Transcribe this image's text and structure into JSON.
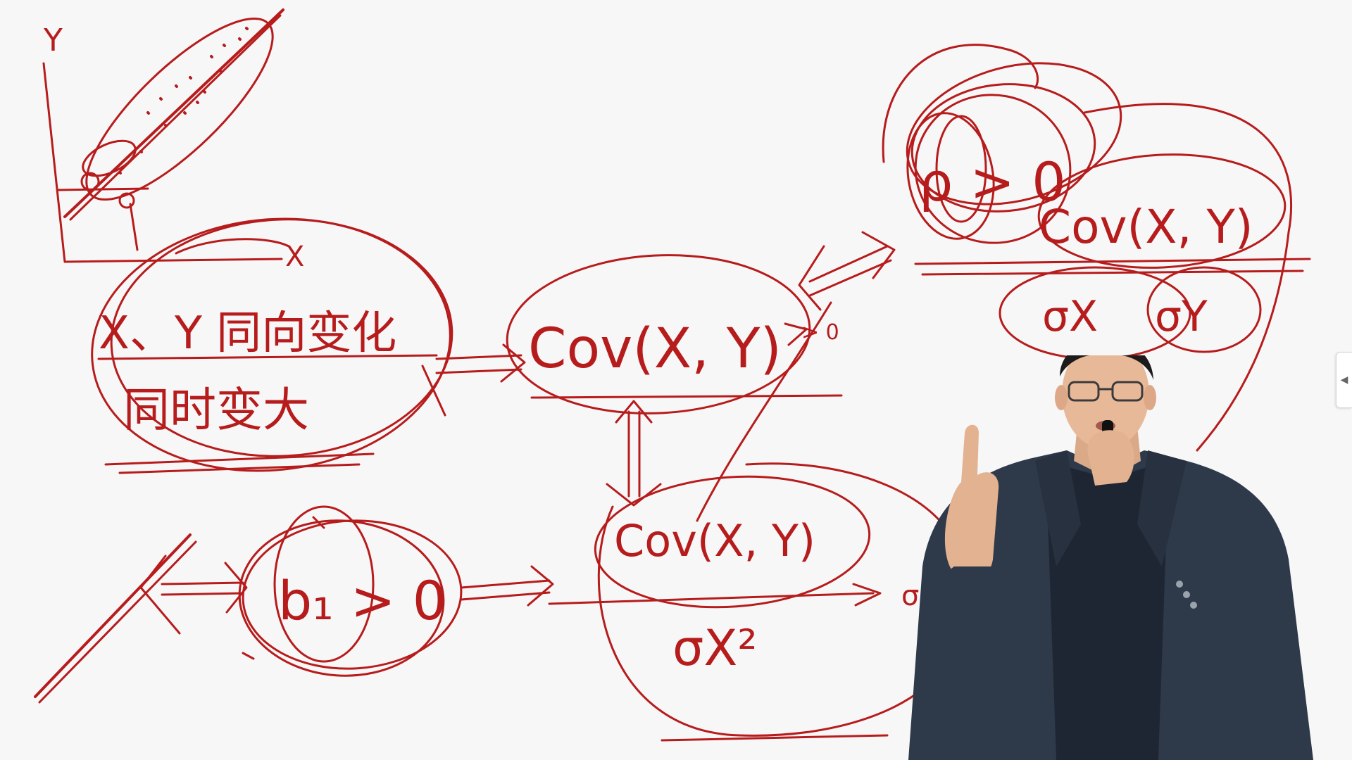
{
  "board": {
    "ink_color": "#b71c1c",
    "background_color": "#f7f7f8",
    "labels": {
      "axis_y": "Y",
      "axis_x": "X",
      "left_oval_line1": "X、Y 同向变化",
      "left_oval_line2": "同时变大",
      "center_top": "Cov(X, Y)",
      "center_top_result": "> 0",
      "center_bottom_num": "Cov(X, Y)",
      "center_bottom_den": "σX²",
      "right_rho": "ρ > 0",
      "right_num": "Cov(X, Y)",
      "right_den_a": "σX",
      "right_den_b": "σY",
      "bottom_left": "b₁ > 0",
      "bottom_right_result": "σ"
    }
  },
  "ui": {
    "side_handle_icon": "◀",
    "side_handle_icon_name": "collapse-left-icon"
  },
  "presenter": {
    "jacket_color": "#2e3a4a",
    "shirt_color": "#1f2633",
    "skin_color": "#e7b999",
    "hair_color": "#1c1a1a"
  }
}
